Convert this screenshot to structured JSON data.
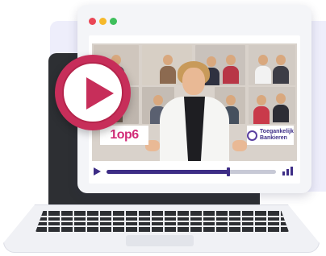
{
  "video": {
    "logo_left": "1op6",
    "logo_right_line1": "Toegankelijk",
    "logo_right_line2": "Bankieren",
    "progress": 0.72
  },
  "icons": {
    "play": "play-icon",
    "volume": "volume-icon"
  },
  "colors": {
    "accent": "#c72e5a",
    "brand_purple": "#3d2d86",
    "laptop": "#2d2f33",
    "panel": "#eeeefb"
  }
}
